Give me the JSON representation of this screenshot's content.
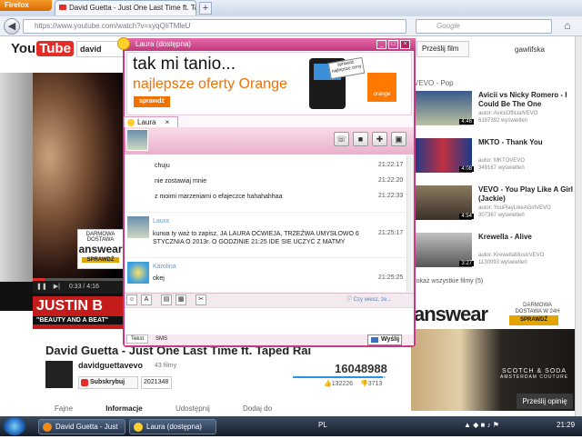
{
  "browser": {
    "menu_label": "Firefox",
    "tab_title": "David Guetta - Just One Last Time ft. Ta...",
    "new_tab": "+",
    "url": "https://www.youtube.com/watch?v=xyqQIiTMleU",
    "search_placeholder": "Google"
  },
  "youtube": {
    "logo_you": "You",
    "logo_tube": "Tube",
    "search_text": "david",
    "upload_label": "Prześlij film",
    "username": "gawlifska",
    "player": {
      "time": "0:33 / 4:16",
      "progress_fraction": 0.13,
      "ad_text": "DARMOWA DOSTAWA",
      "ad_logo": "answear",
      "ad_btn": "SPRAWDŹ",
      "banner_name": "JUSTIN B",
      "banner_sub": "\"BEAUTY AND A BEAT\""
    },
    "video_title": "David Guetta - Just One Last Time ft. Taped Rai",
    "channel": "davidguettavevo",
    "channel_videos": "43 filmy",
    "subscribe_label": "Subskrybuj",
    "subscriber_count": "2021348",
    "views": "16048988",
    "likes": "132226",
    "dislikes": "3713",
    "likes_fraction": 0.97,
    "tabs": [
      "Fajne",
      "Informacje",
      "Udostępnij",
      "Dodaj do"
    ],
    "sidebar_header": "VEVO - Pop",
    "sidebar": [
      {
        "title": "Avicii vs Nicky Romero - I Could Be The One",
        "meta": "autor: AviciiOfficialVEVO",
        "views": "6197392 wyświetleń",
        "duration": "4:46"
      },
      {
        "title": "MKTO - Thank You",
        "meta": "autor: MKTOVEVO",
        "views": "349167 wyświetleń",
        "duration": "4:08"
      },
      {
        "title": "VEVO - You Play Like A Girl (Jackie)",
        "meta": "autor: YouPlayLikeAGirlVEVO",
        "views": "307367 wyświetleń",
        "duration": "4:54"
      },
      {
        "title": "Krewella - Alive",
        "meta": "autor: KrewellaMusicVEVO",
        "views": "1130093 wyświetleń",
        "duration": "3:27"
      }
    ],
    "more_label": "Pokaż wszystkie filmy (5)",
    "ad2": {
      "logo": "answear",
      "delivery": "DARMOWA DOSTAWA W 24H",
      "btn": "SPRAWDŹ",
      "brand": "SCOTCH & SODA",
      "brand_sub": "AMSTERDAM COUTURE"
    },
    "feedback_label": "Prześlij opinię"
  },
  "im": {
    "title": "Laura (dostępna)",
    "banner": {
      "line1": "tak mi tanio...",
      "line2": "najlepsze oferty Orange",
      "btn": "sprawdź",
      "sticker": "sprawdź najlepsze ceny",
      "brand": "orange"
    },
    "tab_name": "Laura",
    "messages": [
      {
        "text": "chuju",
        "time": "21:22:17"
      },
      {
        "text": "nie zostawiaj mnie",
        "time": "21:22:20"
      },
      {
        "text": "z moimi marzeniami o efajeczce hahahahhaa",
        "time": "21:22:33"
      },
      {
        "sender": "Laura",
        "text": "kurwa ty waż to zapisz, JA LAURA OĆWIEJA, TRZEŹWA UMYSŁOWO 6 STYCZNIA O  2013r. O GODZINIE 21:25 IDE SIE UCZYĆ Z MATMY",
        "time": "21:25:17"
      },
      {
        "sender": "Karolina",
        "text": "okej",
        "time": "21:25:25"
      }
    ],
    "hint": "Czy wiesz, że...",
    "bottom_tabs": [
      "Tekst",
      "SMS"
    ],
    "send_label": "Wyślij"
  },
  "taskbar": {
    "items": [
      "David Guetta - Just ...",
      "Laura (dostępna)"
    ],
    "lang": "PL",
    "clock": "21:29"
  },
  "colors": {
    "im_accent": "#c83a86",
    "yt_red": "#e52d27",
    "orange": "#ff7900"
  }
}
